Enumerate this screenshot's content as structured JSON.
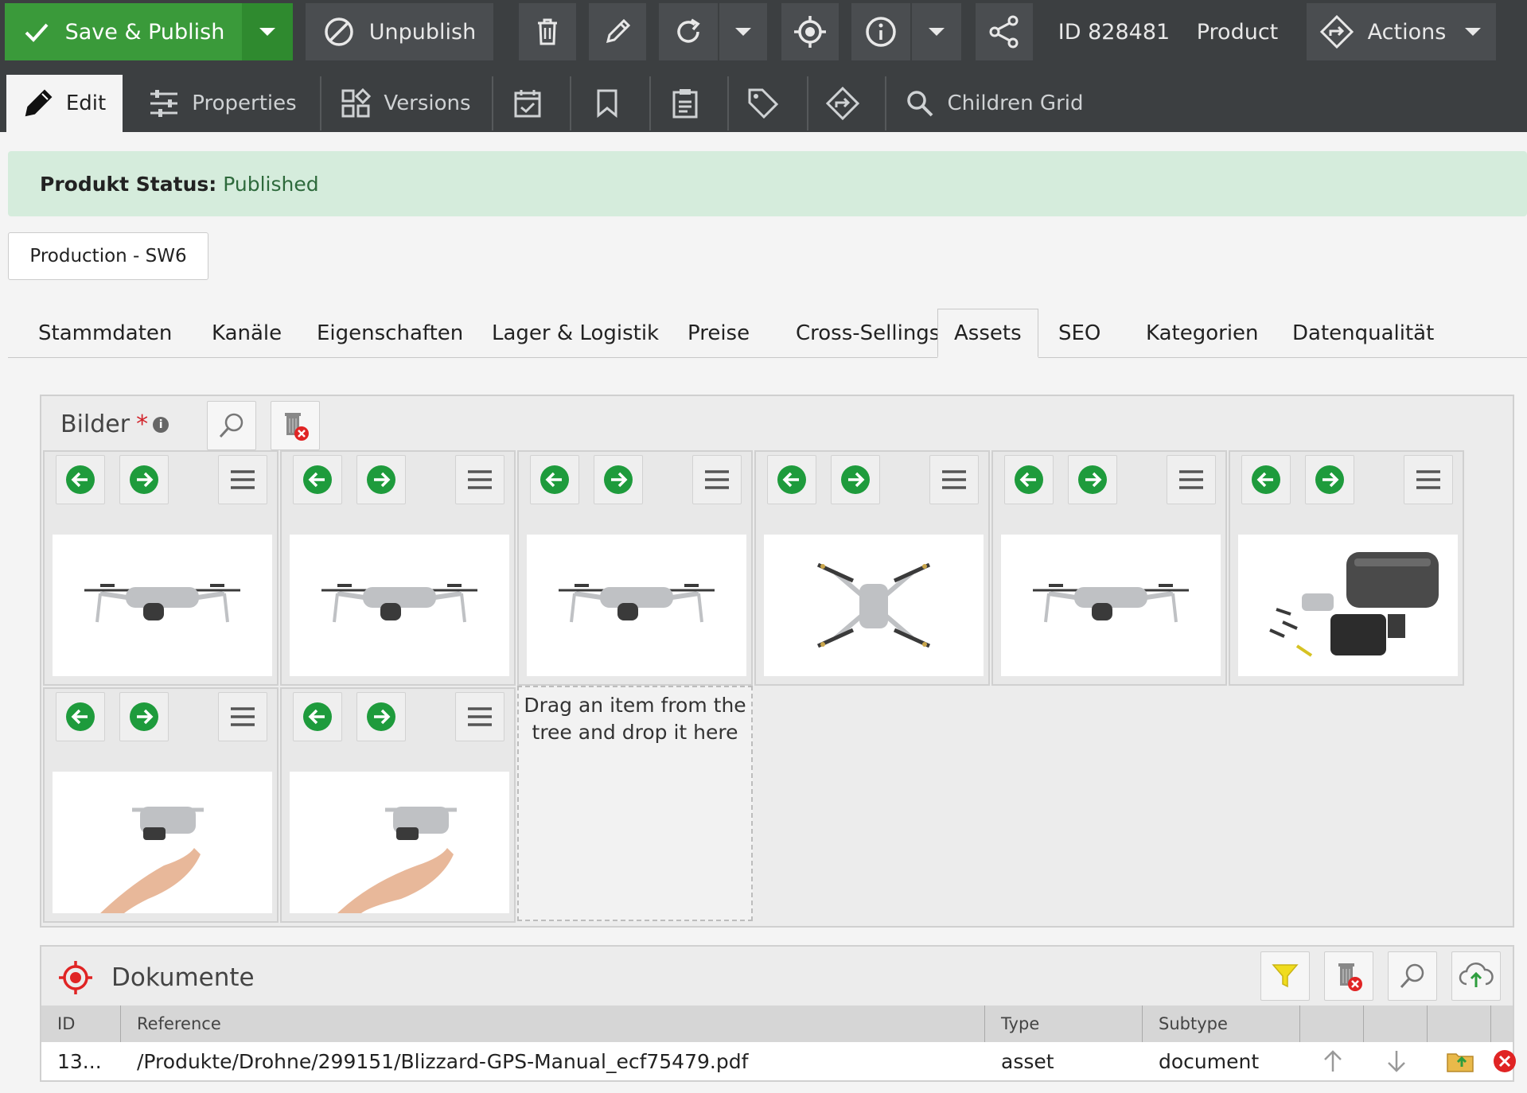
{
  "toolbar": {
    "save_publish": "Save & Publish",
    "unpublish": "Unpublish",
    "id_label": "ID 828481",
    "type_label": "Product",
    "actions": "Actions"
  },
  "subtabs": {
    "edit": "Edit",
    "properties": "Properties",
    "versions": "Versions",
    "children_grid": "Children Grid"
  },
  "status": {
    "label": "Produkt Status:",
    "value": "Published"
  },
  "site_button": "Production - SW6",
  "tabs": [
    "Stammdaten",
    "Kanäle",
    "Eigenschaften",
    "Lager & Logistik",
    "Preise",
    "Cross-Sellings",
    "Assets",
    "SEO",
    "Kategorien",
    "Datenqualität"
  ],
  "active_tab": "Assets",
  "bilder": {
    "title": "Bilder",
    "required_mark": "*",
    "images": [
      "drone-side-view",
      "drone-front-view",
      "drone-front-angled",
      "drone-top-view",
      "drone-rear-angled",
      "drone-accessories-kit",
      "drone-in-hand-1",
      "drone-in-hand-2"
    ],
    "dropzone_text": "Drag an item from the tree and drop it here"
  },
  "dokumente": {
    "title": "Dokumente",
    "columns": [
      "ID",
      "Reference",
      "Type",
      "Subtype"
    ],
    "rows": [
      {
        "id": "13...",
        "reference": "/Produkte/Drohne/299151/Blizzard-GPS-Manual_ecf75479.pdf",
        "type": "asset",
        "subtype": "document"
      }
    ]
  },
  "colors": {
    "green": "#3a9a3a",
    "toolbar": "#3c3f41",
    "status_bg": "#d5ecdc",
    "arrow_green": "#1e9b3c",
    "danger": "#e02424"
  }
}
